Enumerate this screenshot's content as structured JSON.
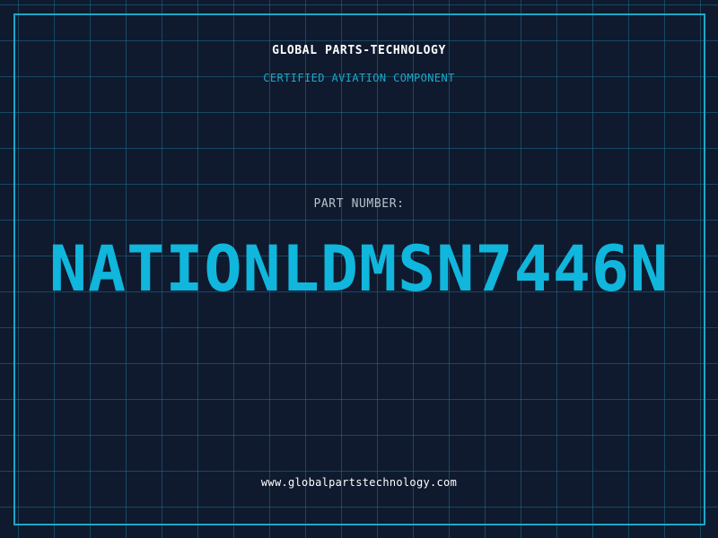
{
  "brand": {
    "name": "GLOBAL PARTS-TECHNOLOGY",
    "tagline": "CERTIFIED AVIATION COMPONENT"
  },
  "part": {
    "label": "PART NUMBER:",
    "number": "NATIONLDMSN7446N"
  },
  "footer": {
    "website": "www.globalpartstechnology.com"
  },
  "colors": {
    "background": "#0f1a2e",
    "accent": "#10b6dc",
    "grid": "#1e6e8c",
    "text": "#ffffff",
    "label": "#b8c1cc"
  }
}
